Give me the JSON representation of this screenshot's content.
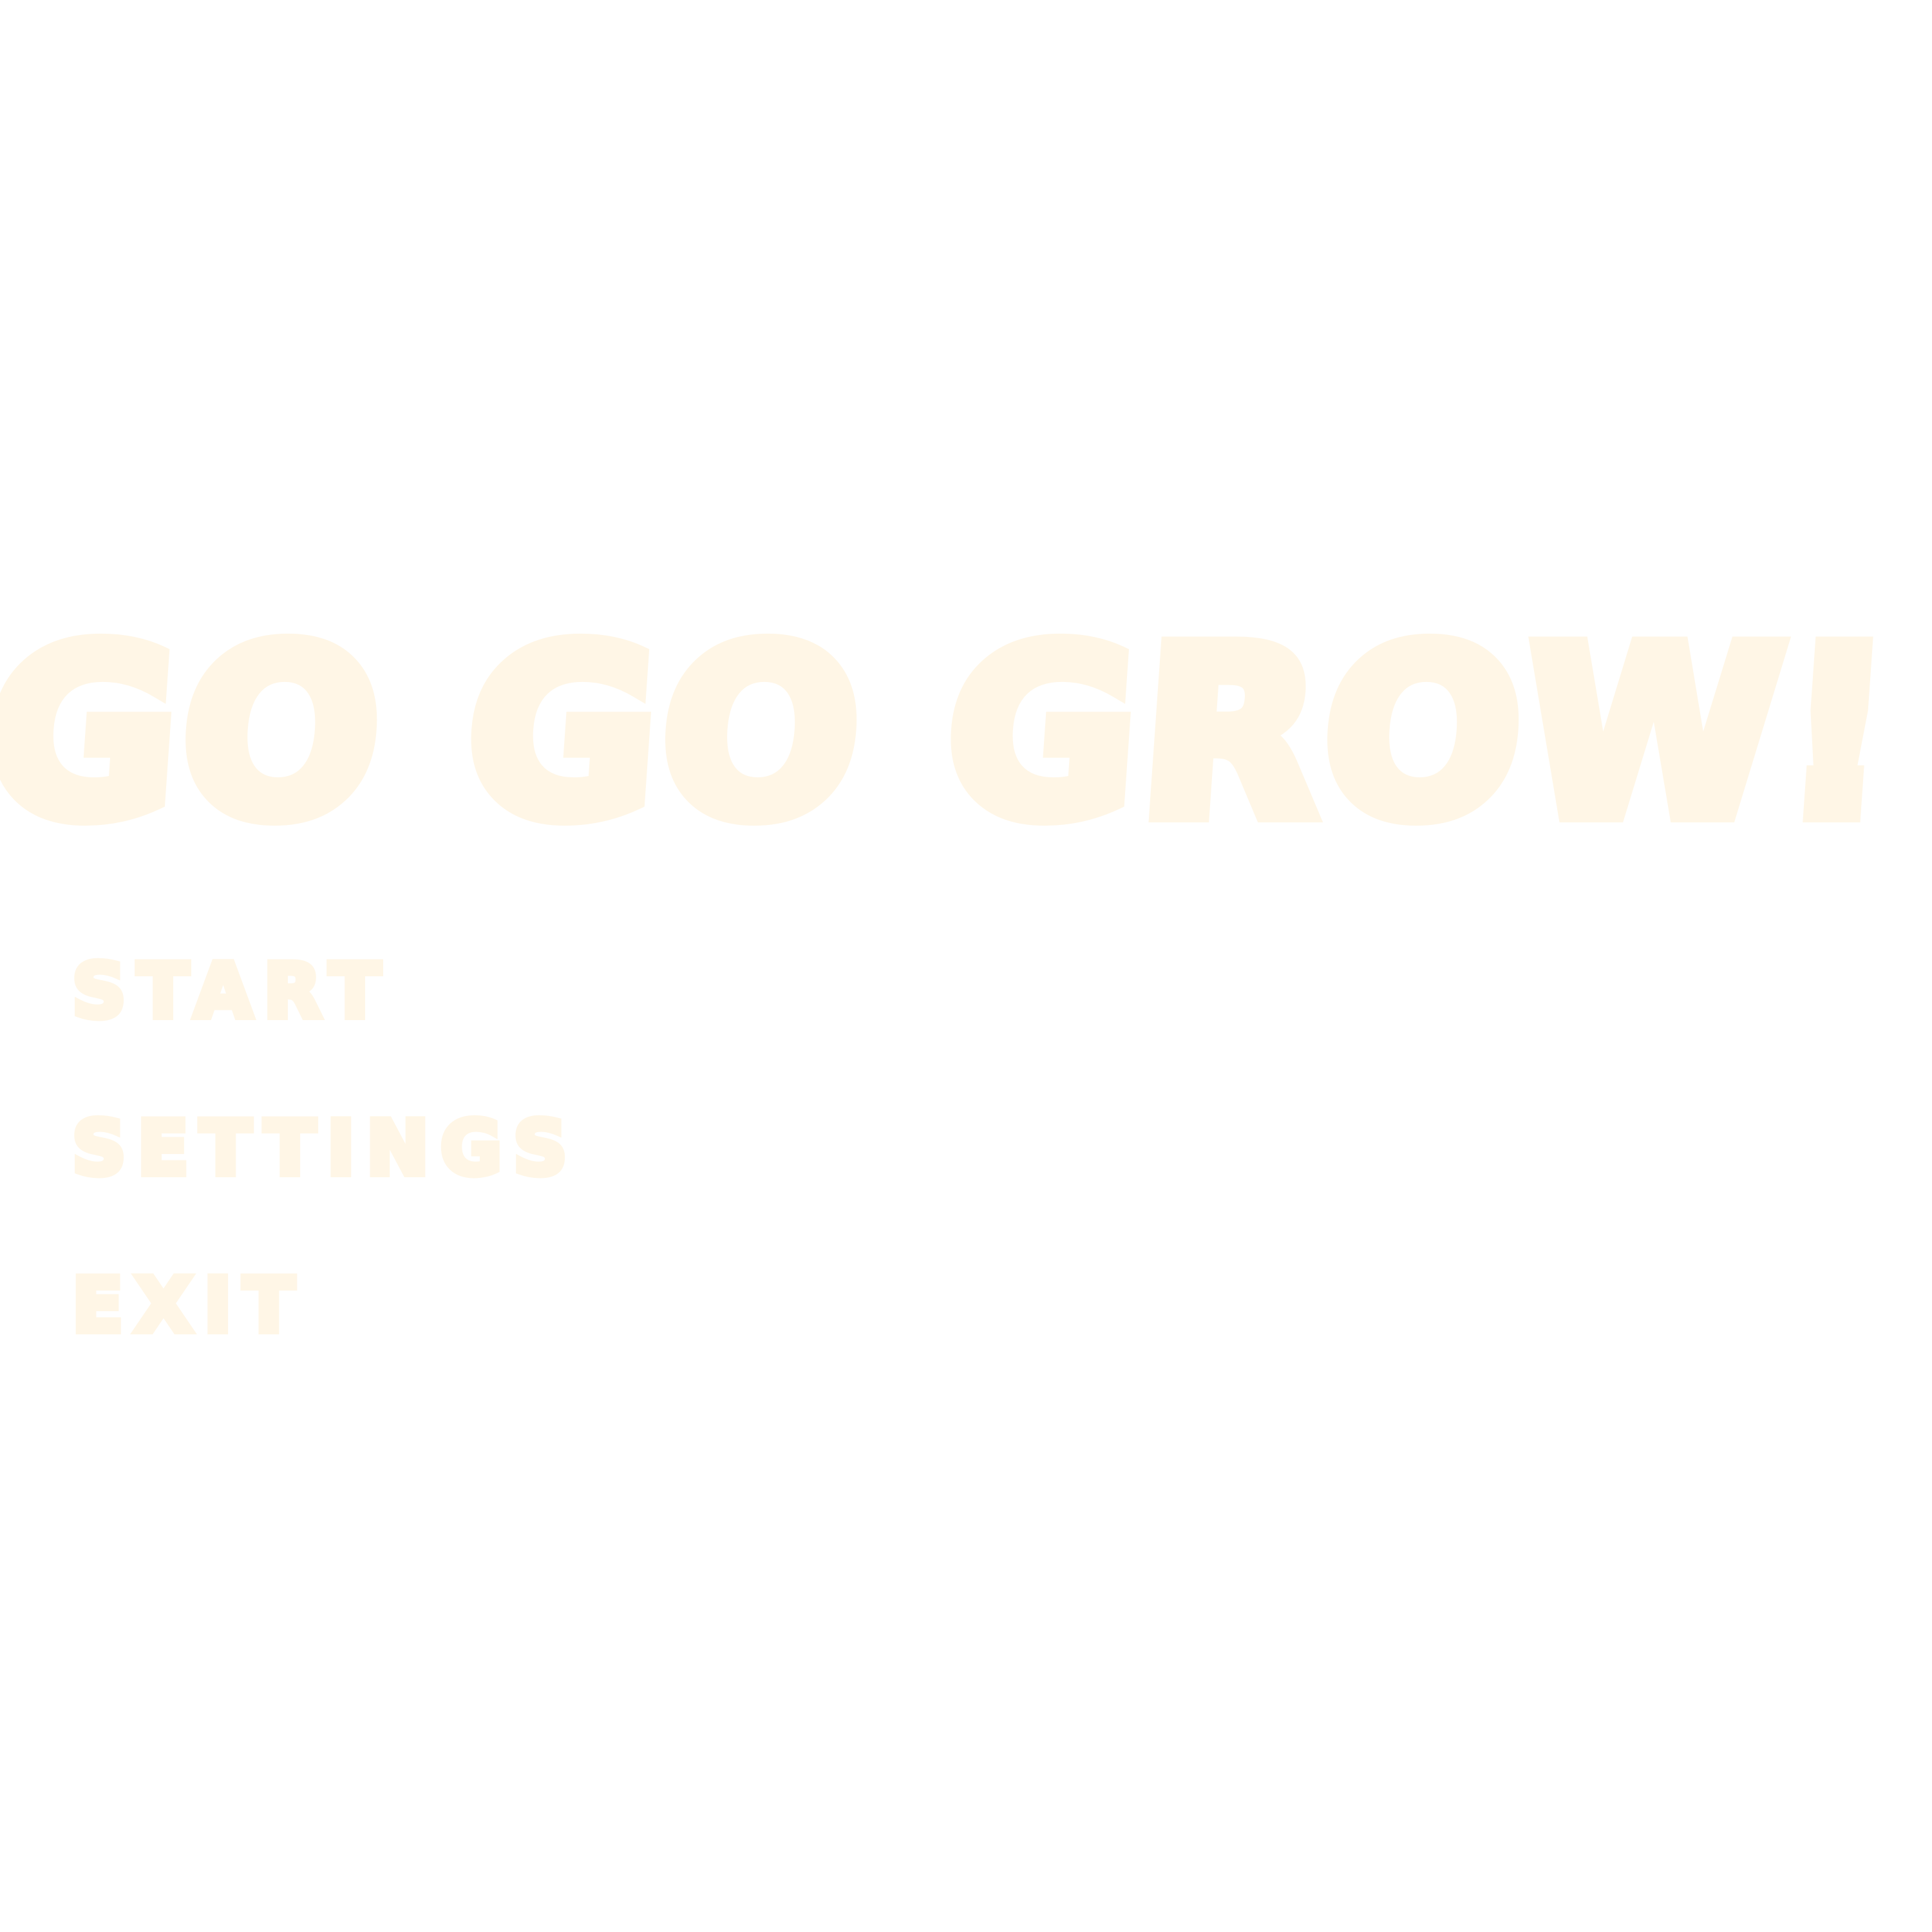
{
  "title": "GO GO GROW!",
  "menu": {
    "start": "START",
    "settings": "SETTINGS",
    "exit": "EXIT"
  },
  "colors": {
    "background": "#ffffff",
    "text": "#fff6e6"
  }
}
